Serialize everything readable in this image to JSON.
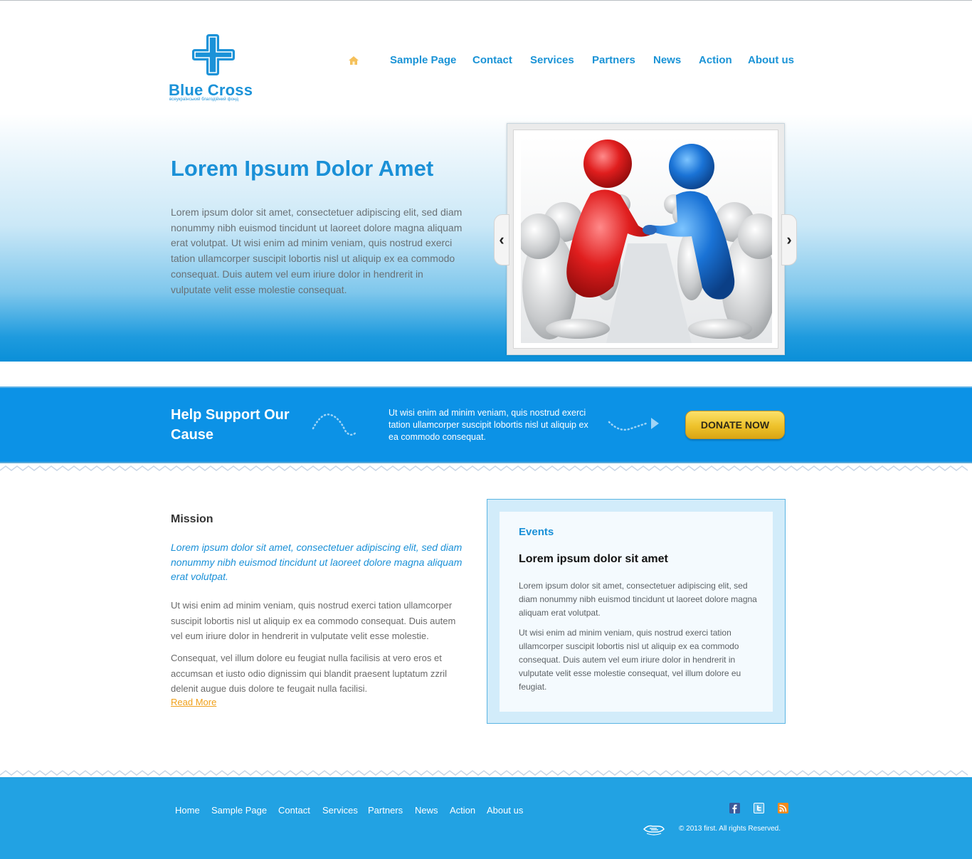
{
  "header": {
    "logo_text": "Blue Cross",
    "logo_subtitle": "всеукраїнський благодійний фонд",
    "nav": [
      "Sample Page",
      "Contact",
      "Services",
      "Partners",
      "News",
      "Action",
      "About us"
    ]
  },
  "hero": {
    "title": "Lorem Ipsum Dolor Amet",
    "text": "Lorem ipsum dolor sit amet, consectetuer adipiscing elit, sed diam nonummy nibh euismod tincidunt ut laoreet dolore magna aliquam erat volutpat. Ut wisi enim ad minim veniam, quis nostrud exerci tation ullamcorper suscipit lobortis nisl ut aliquip ex ea commodo consequat. Duis autem vel eum iriure dolor in hendrerit in vulputate velit esse molestie consequat."
  },
  "slider": {
    "prev_label": "‹",
    "next_label": "›"
  },
  "support": {
    "title": "Help Support Our Cause",
    "text": "Ut wisi enim ad minim veniam, quis nostrud exerci tation ullamcorper suscipit lobortis nisl ut aliquip ex ea commodo consequat.",
    "donate_label": "DONATE NOW"
  },
  "mission": {
    "title": "Mission",
    "lead": "Lorem ipsum dolor sit amet, consectetuer adipiscing elit, sed diam nonummy nibh euismod tincidunt ut laoreet dolore magna aliquam erat volutpat.",
    "p1": "Ut wisi enim ad minim veniam, quis nostrud exerci tation ullamcorper suscipit lobortis nisl ut aliquip ex ea commodo consequat. Duis autem vel eum iriure dolor in hendrerit in vulputate velit esse molestie.",
    "p2": "Consequat, vel illum dolore eu feugiat nulla facilisis at vero eros et accumsan et iusto odio dignissim qui blandit praesent luptatum zzril delenit augue duis dolore te feugait nulla facilisi.",
    "read_more": "Read More"
  },
  "events": {
    "title": "Events",
    "headline": "Lorem ipsum dolor sit amet",
    "p1": "Lorem ipsum dolor sit amet, consectetuer adipiscing elit, sed diam nonummy nibh euismod tincidunt ut laoreet dolore magna aliquam erat volutpat.",
    "p2": "Ut wisi enim ad minim veniam, quis nostrud exerci tation ullamcorper suscipit lobortis nisl ut aliquip ex ea commodo consequat. Duis autem vel eum iriure dolor in hendrerit in vulputate velit esse molestie consequat, vel illum dolore eu feugiat."
  },
  "footer": {
    "nav": [
      "Home",
      "Sample Page",
      "Contact",
      "Services",
      "Partners",
      "News",
      "Action",
      "About us"
    ],
    "copyright": "© 2013 first. All rights Reserved.",
    "social": [
      "facebook-icon",
      "twitter-icon",
      "rss-icon"
    ]
  },
  "colors": {
    "brand_blue": "#1a90d7",
    "support_band": "#0c92e6",
    "footer": "#22a2e3",
    "donate_yellow": "#eec22b",
    "read_more": "#f0a01a"
  }
}
